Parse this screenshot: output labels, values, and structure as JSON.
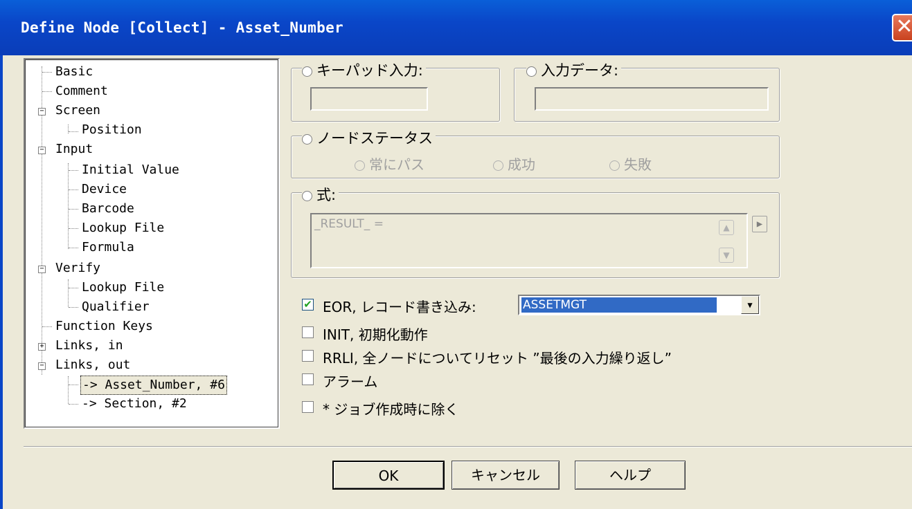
{
  "window": {
    "title": "Define Node [Collect] - Asset_Number",
    "close_icon": "close-x-icon"
  },
  "tree": {
    "items": [
      {
        "label": "Basic"
      },
      {
        "label": "Comment"
      },
      {
        "label": "Screen",
        "expander": "−"
      },
      {
        "label": "Position"
      },
      {
        "label": "Input",
        "expander": "−"
      },
      {
        "label": "Initial Value"
      },
      {
        "label": "Device"
      },
      {
        "label": "Barcode"
      },
      {
        "label": "Lookup File"
      },
      {
        "label": "Formula"
      },
      {
        "label": "Verify",
        "expander": "−"
      },
      {
        "label": "Lookup File"
      },
      {
        "label": "Qualifier"
      },
      {
        "label": "Function Keys"
      },
      {
        "label": "Links, in",
        "expander": "+"
      },
      {
        "label": "Links, out",
        "expander": "−"
      },
      {
        "label": "-> Asset_Number, #6",
        "selected": true
      },
      {
        "label": "-> Section, #2"
      }
    ]
  },
  "keypad": {
    "label": "キーパッド入力:",
    "value": ""
  },
  "input_data": {
    "label": "入力データ:",
    "value": ""
  },
  "node_status": {
    "label": "ノードステータス",
    "options": [
      "常にパス",
      "成功",
      "失敗"
    ]
  },
  "expression": {
    "label": "式:",
    "value": "_RESULT_ ="
  },
  "checkboxes": {
    "eor": {
      "label": "EOR, レコード書き込み:",
      "checked": true
    },
    "init": {
      "label": "INIT, 初期化動作",
      "checked": false
    },
    "rrli": {
      "label": "RRLI, 全ノードについてリセット ”最後の入力繰り返し”",
      "checked": false
    },
    "alarm": {
      "label": "アラーム",
      "checked": false
    },
    "exclude": {
      "label": "* ジョブ作成時に除く",
      "checked": false
    }
  },
  "record_select": {
    "value": "ASSETMGT"
  },
  "buttons": {
    "ok": "OK",
    "cancel": "キャンセル",
    "help": "ヘルプ"
  },
  "glyphs": {
    "check": "✔",
    "dropdown": "▼",
    "up": "▲",
    "down": "▼",
    "right": "▶",
    "close": "✕"
  }
}
